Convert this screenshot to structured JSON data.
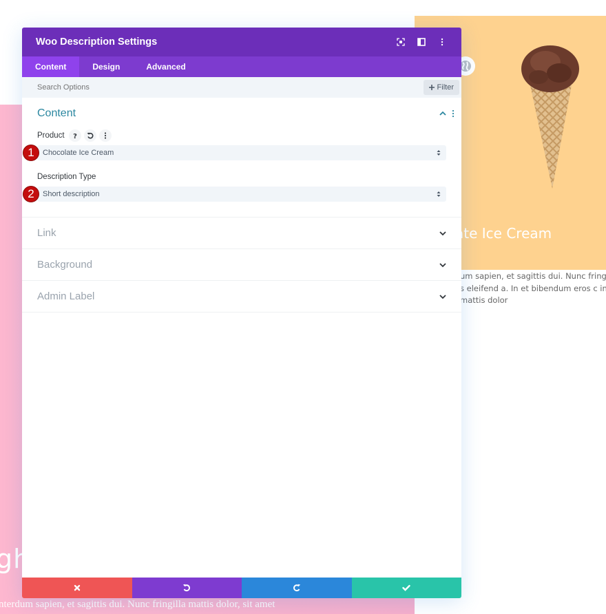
{
  "background": {
    "pink_heading_partial": "gh",
    "pink_text_partial": "nterdum sapien, et sagittis dui. Nunc fringilla mattis dolor, sit amet",
    "product_title_partial": "ocolate Ice Cream",
    "product_desc_lines": [
      "um sapien, et sagittis dui. Nunc fringilla mat",
      "s eleifend a. In et bibendum eros c interdur",
      "mattis dolor"
    ],
    "product_image": "chocolate-ice-cream-cone",
    "colors": {
      "pink": "#fdb7cf",
      "card": "#fed28f"
    }
  },
  "modal": {
    "title": "Woo Description Settings",
    "header_icons": [
      "expand-icon",
      "split-view-icon",
      "more-vertical-icon"
    ],
    "tabs": [
      {
        "label": "Content",
        "active": true
      },
      {
        "label": "Design",
        "active": false
      },
      {
        "label": "Advanced",
        "active": false
      }
    ],
    "search": {
      "placeholder": "Search Options",
      "value": ""
    },
    "filter_label": "Filter",
    "sections": {
      "content": {
        "title": "Content",
        "expanded": true,
        "fields": [
          {
            "label": "Product",
            "value": "Chocolate Ice Cream",
            "badge": "1",
            "icons": [
              "help-icon",
              "reset-icon",
              "more-vertical-icon"
            ]
          },
          {
            "label": "Description Type",
            "value": "Short description",
            "badge": "2"
          }
        ]
      },
      "collapsed": [
        {
          "title": "Link"
        },
        {
          "title": "Background"
        },
        {
          "title": "Admin Label"
        }
      ]
    },
    "footer": {
      "cancel": "close-icon",
      "undo": "undo-icon",
      "redo": "redo-icon",
      "save": "check-icon"
    },
    "colors": {
      "header": "#6c2eb9",
      "tabs": "#7d3bcf",
      "active_tab": "#8f42ec",
      "section_title": "#2b87a0",
      "cancel": "#ef5555",
      "undo": "#7e3bd0",
      "redo": "#2b87da",
      "save": "#29c4a9"
    }
  }
}
